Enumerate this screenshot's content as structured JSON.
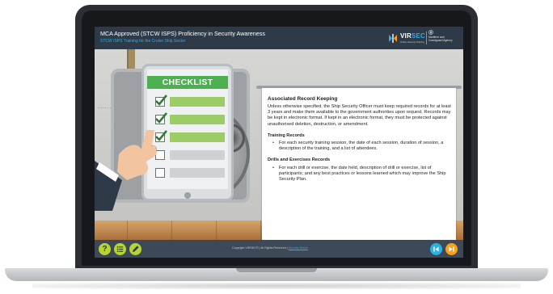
{
  "course": {
    "title": "MCA Approved (STCW ISPS) Proficiency in Security Awareness",
    "subtitle": "STCW ISPS Training for the Cruise Ship Sector"
  },
  "branding": {
    "virsec_vir": "VIR",
    "virsec_sec": "SEC",
    "virsec_tagline": "Online Security Training",
    "mca_name": "Maritime and\nCoastguard Agency"
  },
  "illustration": {
    "checklist_label": "CHECKLIST",
    "items": [
      {
        "checked": true
      },
      {
        "checked": true
      },
      {
        "checked": true
      },
      {
        "checked": false
      },
      {
        "checked": false
      }
    ]
  },
  "board": {
    "heading": "Associated Record Keeping",
    "intro": "Unless otherwise specified, the Ship Security Officer must keep required records for at least 3 years and make them available to the government authorities upon request. Records may be kept in electronic format. If kept in an electronic format, they must be protected against unauthorised deletion, destruction, or amendment.",
    "training_heading": "Training Records",
    "training_bullet": "For each security training session, the date of each session, duration of session, a description of the training, and a list of attendees.",
    "drills_heading": "Drills and Exercises Records",
    "drills_bullet": "For each drill or exercise, the date held, description of drill or exercise, list of participants; and any best practices or lessons learned which may improve the Ship Security Plan."
  },
  "footer": {
    "help_label": "?",
    "copyright": "Copyright VIRSEC® | All Rights Reserved |",
    "security_notice": "Security Notice"
  },
  "colors": {
    "accent_blue": "#27b3e8",
    "accent_green": "#b8d431",
    "accent_orange": "#f5a21a",
    "checklist_green": "#4caf50"
  }
}
